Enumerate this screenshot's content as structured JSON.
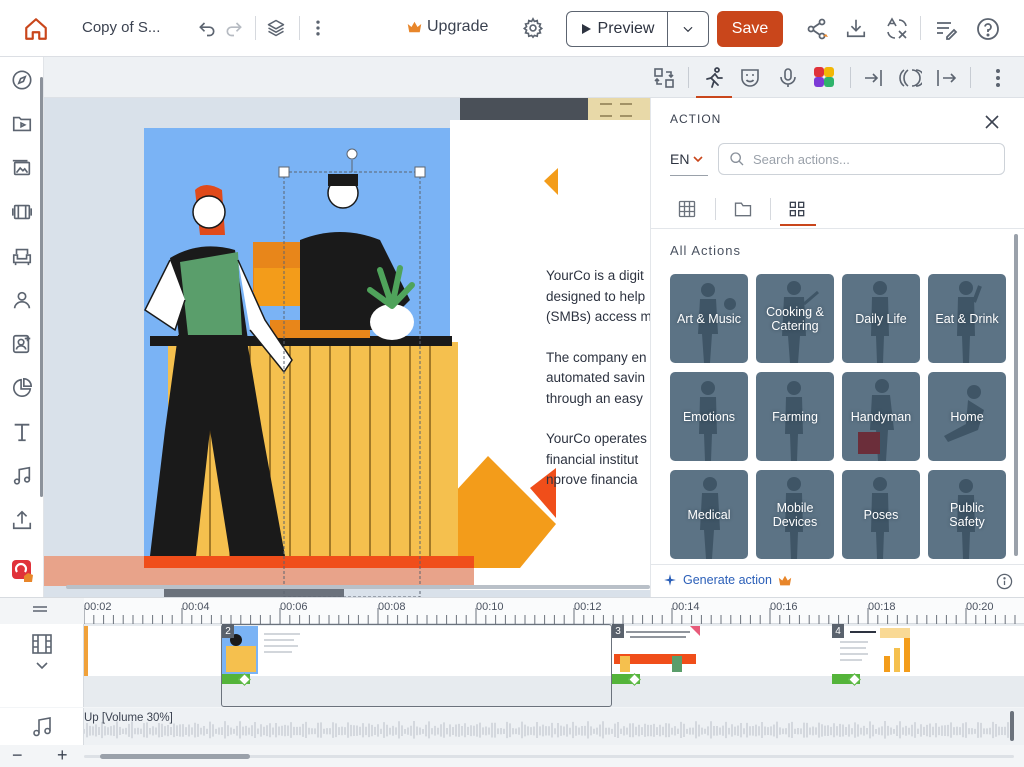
{
  "header": {
    "doc_title": "Copy of S...",
    "upgrade_label": "Upgrade",
    "preview_label": "Preview",
    "save_label": "Save"
  },
  "slide": {
    "paragraphs": [
      [
        "YourCo is a digit",
        "designed to help",
        "(SMBs) access m"
      ],
      [
        "The company en",
        "automated savin",
        "through an easy"
      ],
      [
        "YourCo operates",
        "financial institut",
        "nprove financia"
      ]
    ]
  },
  "action_panel": {
    "title": "ACTION",
    "language": "EN",
    "search_placeholder": "Search actions...",
    "section_label": "All Actions",
    "categories": [
      "Art & Music",
      "Cooking & Catering",
      "Daily Life",
      "Eat & Drink",
      "Emotions",
      "Farming",
      "Handyman",
      "Home",
      "Medical",
      "Mobile Devices",
      "Poses",
      "Public Safety"
    ],
    "generate_label": "Generate action"
  },
  "timeline": {
    "ticks": [
      "00:02",
      "00:04",
      "00:06",
      "00:08",
      "00:10",
      "00:12",
      "00:14",
      "00:16",
      "00:18",
      "00:20"
    ],
    "scenes": [
      "2",
      "3",
      "4"
    ],
    "audio_label": "Up [Volume 30%]",
    "zoom_out": "−",
    "zoom_in": "+"
  },
  "colors": {
    "accent": "#c9461b",
    "tile": "#5c7385",
    "link": "#2b5fb8",
    "keyframe": "#54b43a"
  }
}
